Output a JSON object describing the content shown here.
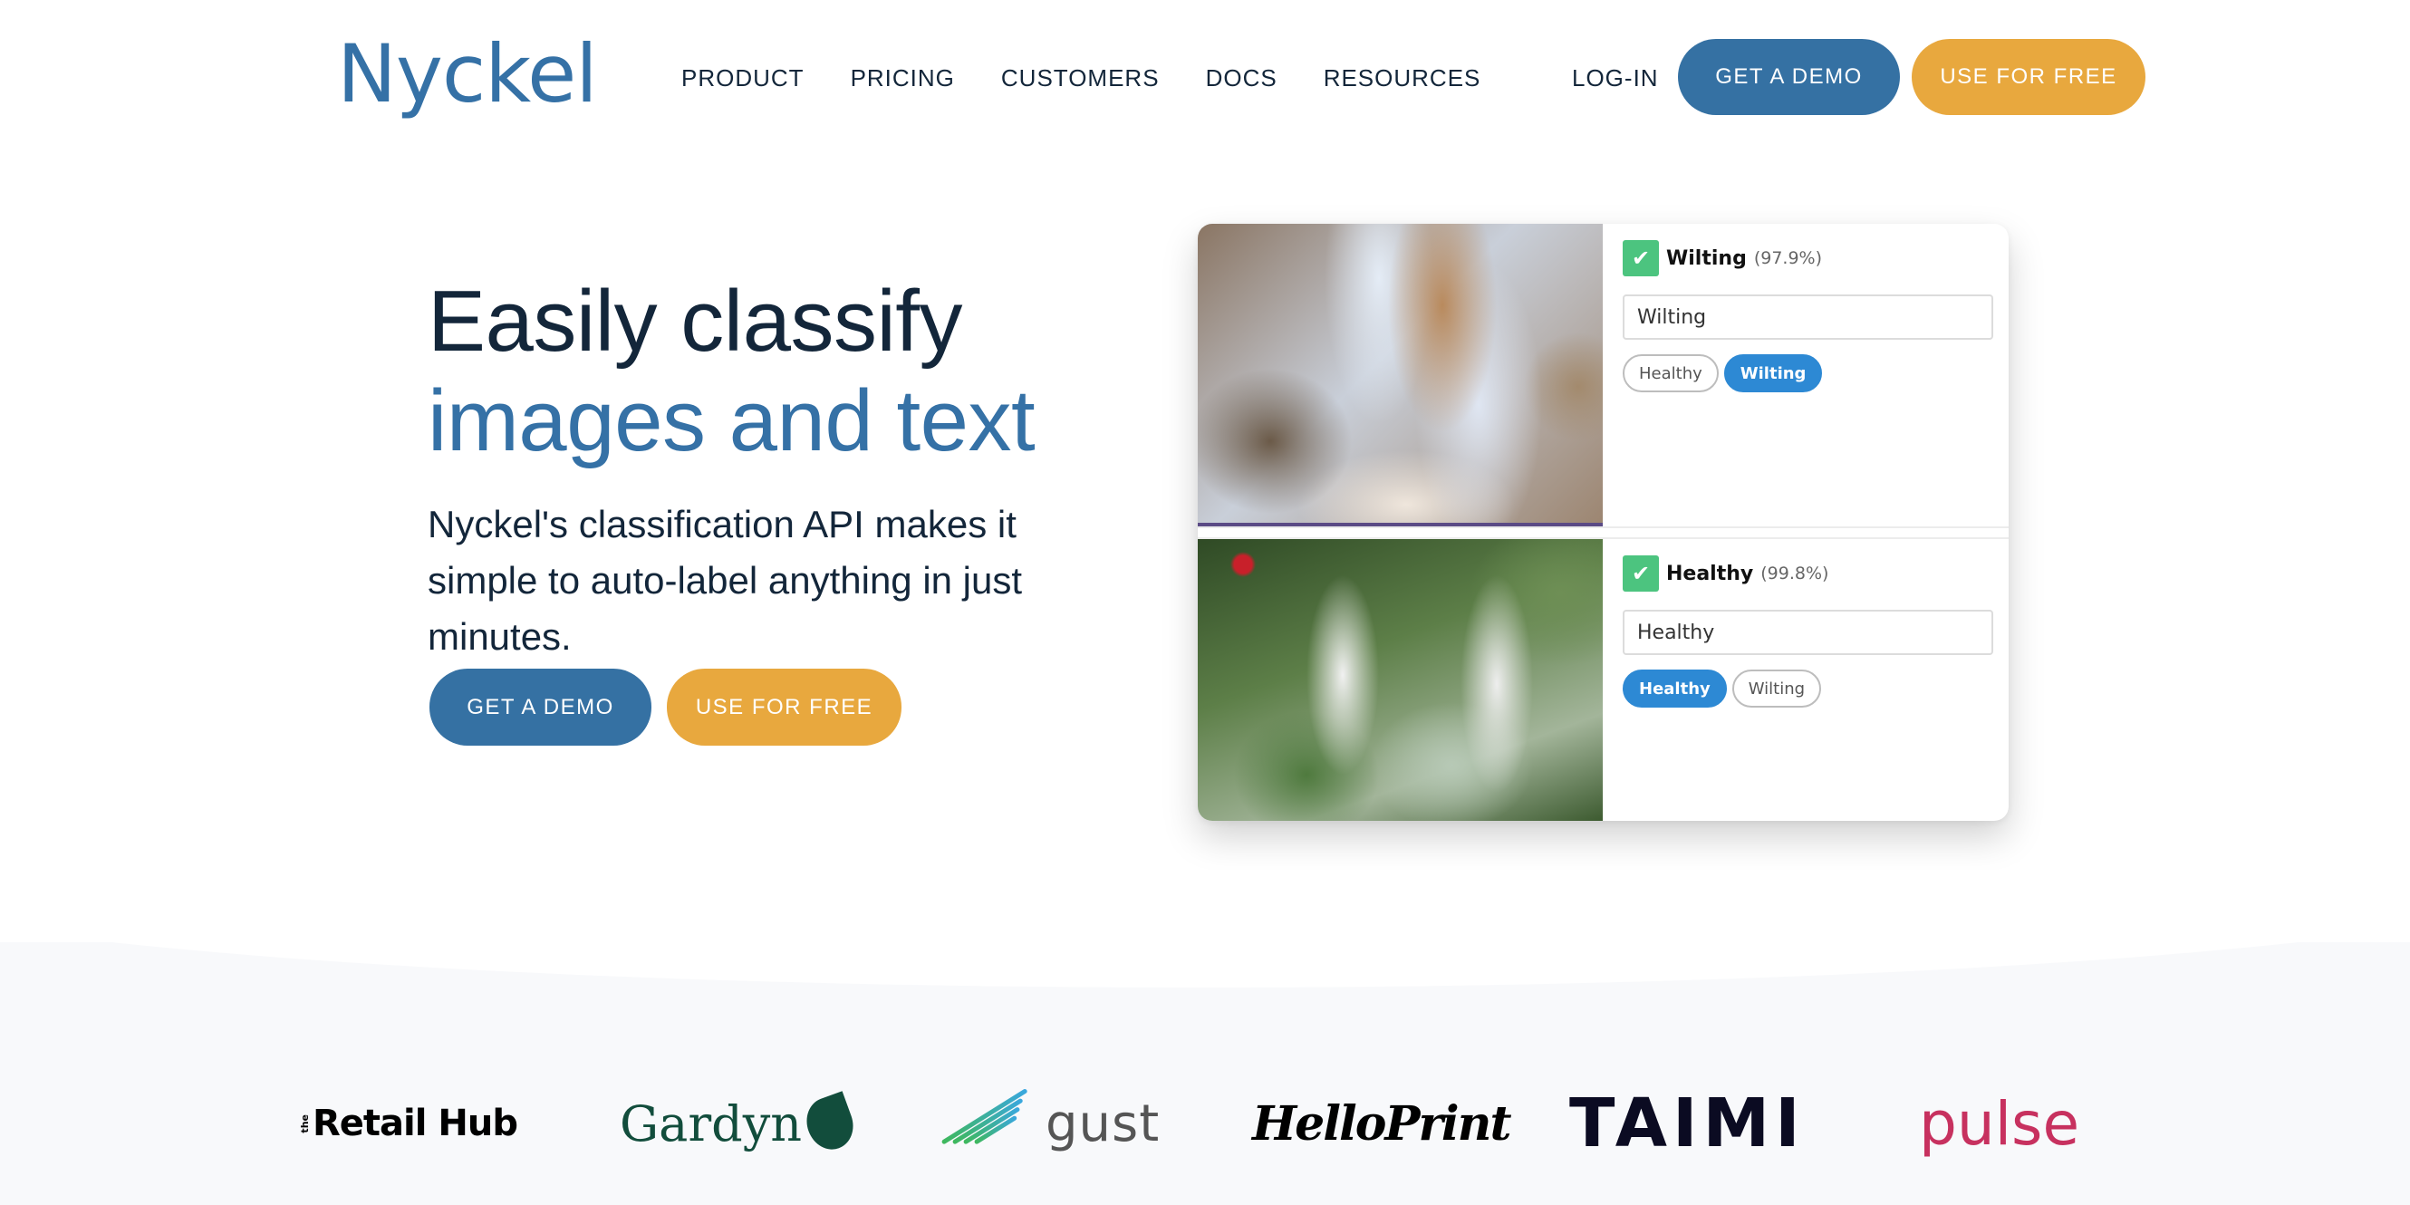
{
  "nav": {
    "brand": "Nyckel",
    "links": [
      "PRODUCT",
      "PRICING",
      "CUSTOMERS",
      "DOCS",
      "RESOURCES"
    ],
    "login": "LOG-IN",
    "demo_button": "GET A DEMO",
    "free_button": "USE FOR FREE"
  },
  "hero": {
    "title_line1": "Easily classify",
    "title_line2": "images and text",
    "subtitle": "Nyckel's classification API makes it simple to auto-label anything in just minutes.",
    "demo_button": "GET A DEMO",
    "free_button": "USE FOR FREE"
  },
  "demo": {
    "items": [
      {
        "image": "wilting-plant-photo",
        "prediction": "Wilting",
        "confidence": "(97.9%)",
        "input_value": "Wilting",
        "chips": [
          {
            "label": "Healthy",
            "selected": false
          },
          {
            "label": "Wilting",
            "selected": true
          }
        ]
      },
      {
        "image": "healthy-plant-photo",
        "prediction": "Healthy",
        "confidence": "(99.8%)",
        "input_value": "Healthy",
        "chips": [
          {
            "label": "Healthy",
            "selected": true
          },
          {
            "label": "Wilting",
            "selected": false
          }
        ]
      }
    ]
  },
  "customers": {
    "logos": [
      {
        "name": "the Retail Hub",
        "prefix": "the",
        "text": "Retail Hub"
      },
      {
        "name": "Gardyn",
        "text": "Gardyn"
      },
      {
        "name": "gust",
        "text": "gust"
      },
      {
        "name": "HelloPrint",
        "text": "HelloPrint"
      },
      {
        "name": "TAIMI",
        "text": "TAIMI"
      },
      {
        "name": "pulse",
        "text": "pulse"
      }
    ]
  },
  "colors": {
    "brand_blue": "#3571a3",
    "accent_orange": "#e8a83e",
    "heading_dark": "#13263a",
    "check_green": "#4cc47f",
    "chip_blue": "#2d89d4"
  }
}
